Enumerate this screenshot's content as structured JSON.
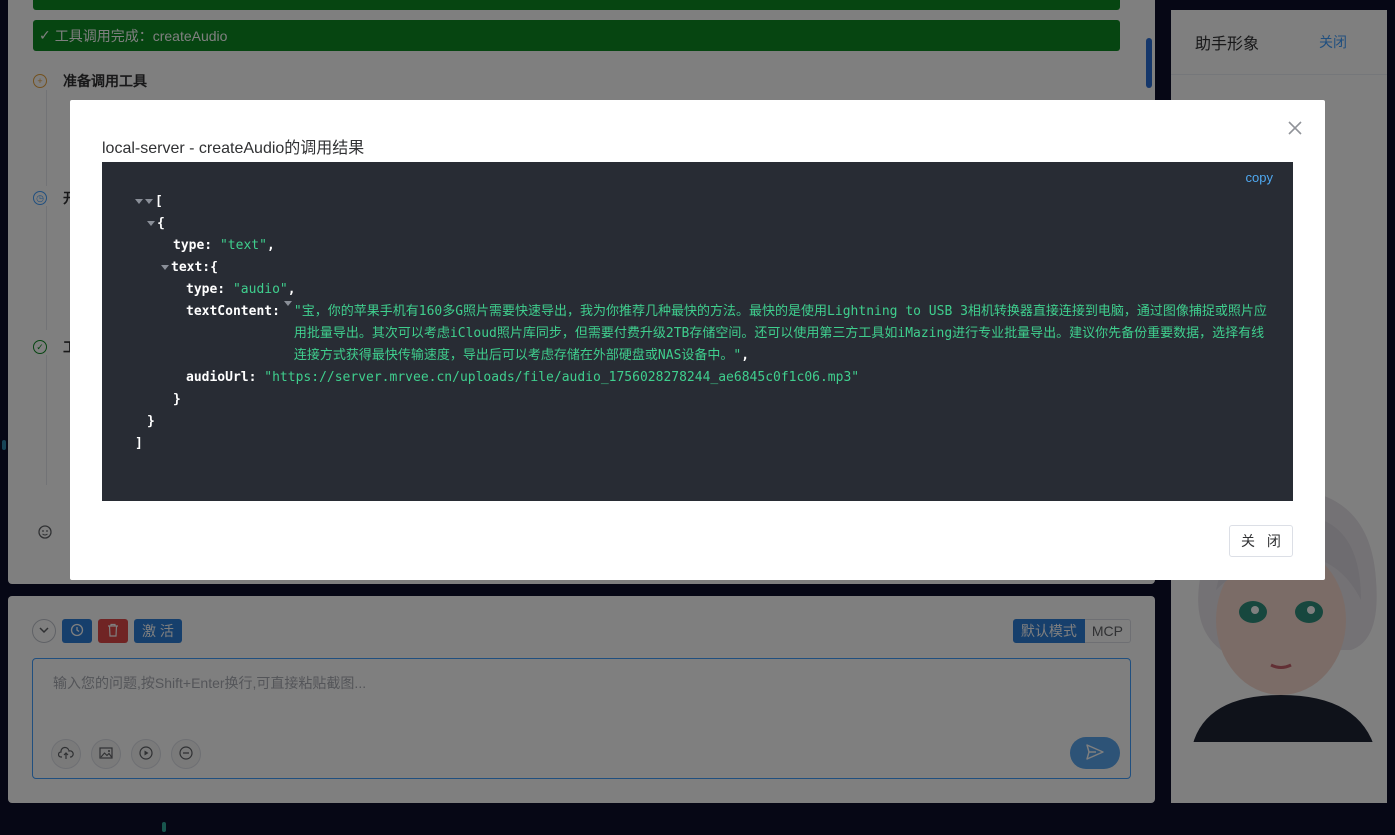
{
  "chat": {
    "tool_done_label": "工具调用完成：createAudio",
    "step1_title": "准备调用工具",
    "step2_title": "开",
    "step3_title": "工",
    "sub_prefix_a": "[",
    "sub_prefix_b": "["
  },
  "avatar": {
    "title": "助手形象",
    "close_label": "关闭"
  },
  "input": {
    "activate_label": "激 活",
    "mode_default": "默认模式",
    "mode_mcp": "MCP",
    "placeholder": "输入您的问题,按Shift+Enter换行,可直接粘贴截图..."
  },
  "modal": {
    "title": "local-server - createAudio的调用结果",
    "copy_label": "copy",
    "footer_close": "关 闭",
    "json": {
      "open_bracket": "[",
      "open_brace": "{",
      "type_key": "type:",
      "type_val": "\"text\"",
      "text_key": "text:",
      "inner_type_val": "\"audio\"",
      "textContent_key": "textContent:",
      "textContent_val": "\"宝，你的苹果手机有160多G照片需要快速导出，我为你推荐几种最快的方法。最快的是使用Lightning to USB 3相机转换器直接连接到电脑，通过图像捕捉或照片应用批量导出。其次可以考虑iCloud照片库同步，但需要付费升级2TB存储空间。还可以使用第三方工具如iMazing进行专业批量导出。建议你先备份重要数据，选择有线连接方式获得最快传输速度，导出后可以考虑存储在外部硬盘或NAS设备中。\"",
      "audioUrl_key": "audioUrl:",
      "audioUrl_val": "\"https://server.mrvee.cn/uploads/file/audio_1756028278244_ae6845c0f1c06.mp3\"",
      "close_brace": "}",
      "close_bracket": "]"
    }
  },
  "colors": {
    "success_green": "#0d8a23",
    "primary_blue": "#2d7fd9",
    "danger_red": "#e04848",
    "code_bg": "#282c34",
    "json_string": "#3fcf8e"
  }
}
